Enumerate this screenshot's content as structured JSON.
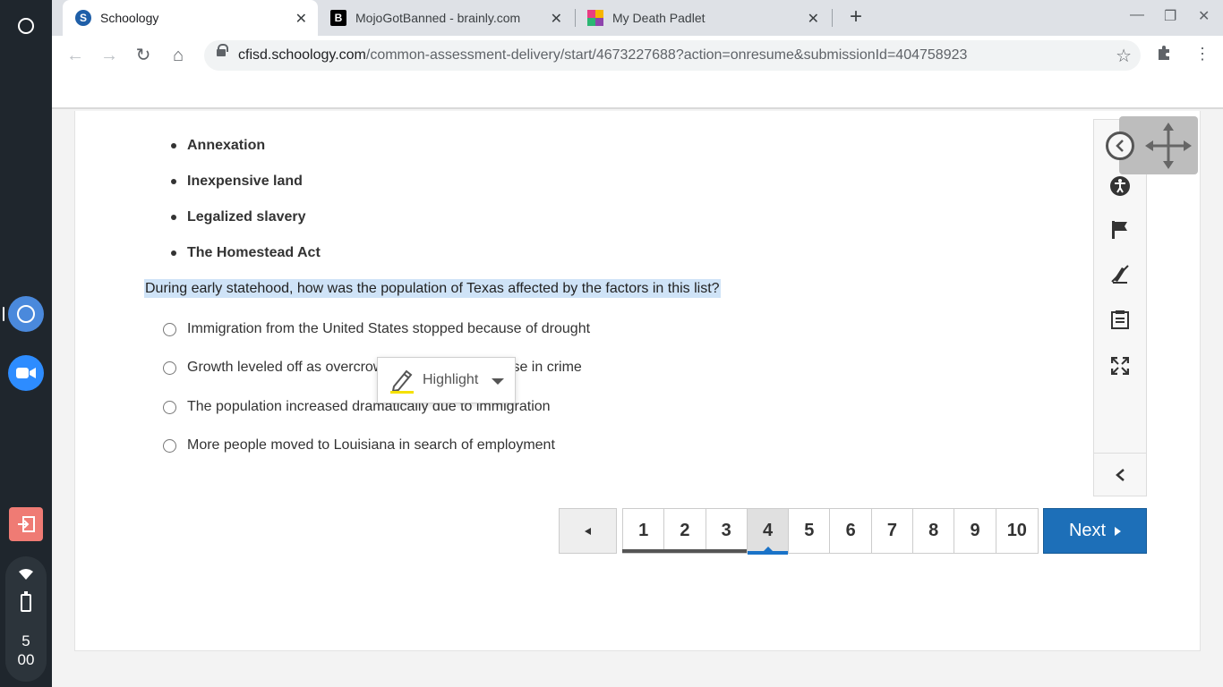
{
  "browser": {
    "tabs": [
      {
        "title": "Schoology",
        "favicon": "S"
      },
      {
        "title": "MojoGotBanned - brainly.com",
        "favicon": "B"
      },
      {
        "title": "My Death Padlet",
        "favicon": "padlet"
      }
    ],
    "url_host": "cfisd.schoology.com",
    "url_path": "/common-assessment-delivery/start/4673227688?action=onresume&submissionId=404758923"
  },
  "shelf": {
    "clock_hour": "5",
    "clock_min": "00"
  },
  "question": {
    "factors": [
      "Annexation",
      "Inexpensive land",
      "Legalized slavery",
      "The Homestead Act"
    ],
    "prompt": "During early statehood, how was the population of Texas affected by the factors in this list?",
    "choices": [
      {
        "text": "Immigration from the United States stopped because of drought"
      },
      {
        "text": "Growth leveled off as overcrowding led to an increase in crime"
      },
      {
        "text": "The population increased dramatically due to immigration"
      },
      {
        "text": "More people moved to Louisiana in search of employment"
      }
    ]
  },
  "highlight_popup": {
    "label": "Highlight",
    "accent": "#f5e100"
  },
  "pagination": {
    "pages": [
      "1",
      "2",
      "3",
      "4",
      "5",
      "6",
      "7",
      "8",
      "9",
      "10"
    ],
    "current": "4",
    "next_label": "Next"
  },
  "colors": {
    "selection": "#cfe3f7",
    "next_button": "#1d6fb8"
  }
}
